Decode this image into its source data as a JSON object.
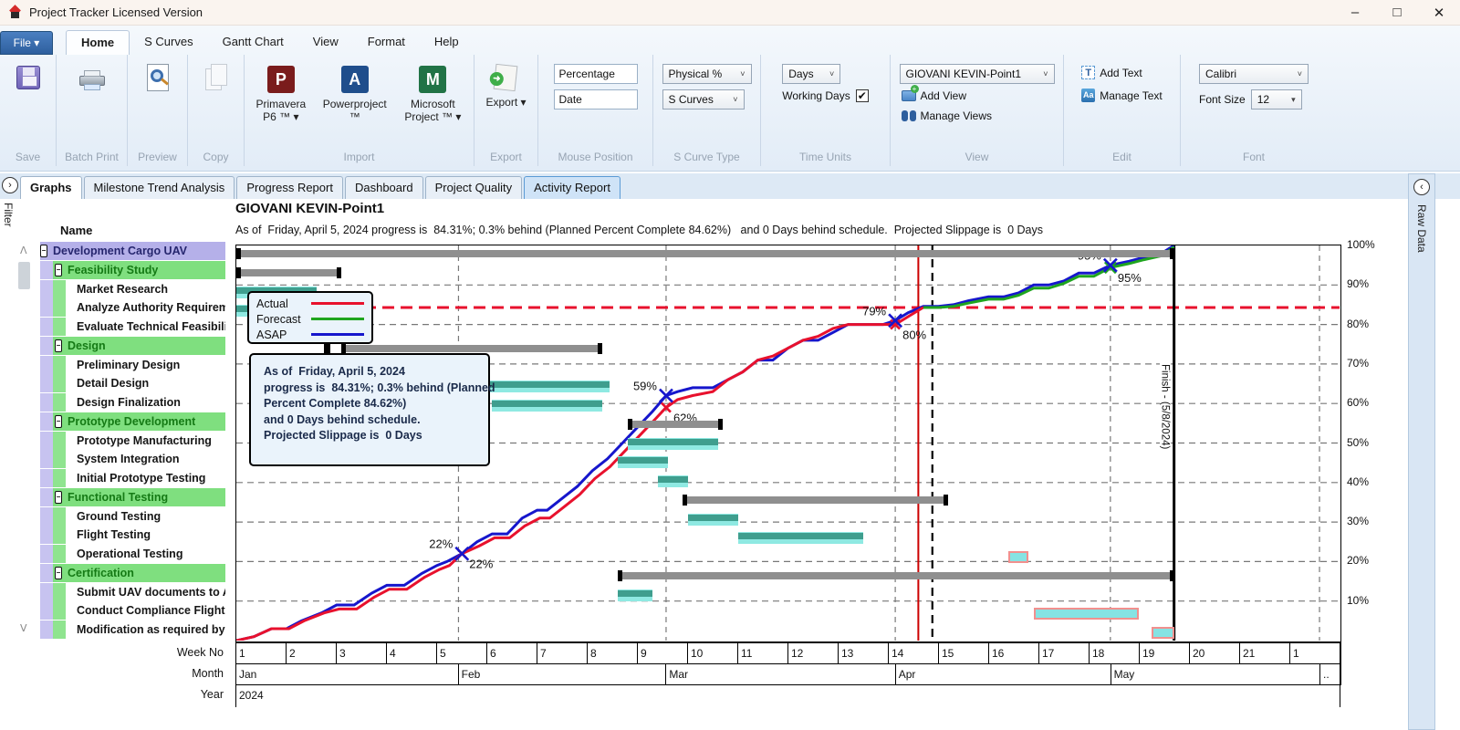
{
  "window": {
    "title": "Project Tracker Licensed Version",
    "controls": {
      "minimize": "–",
      "maximize": "□",
      "close": "✕"
    }
  },
  "menu": {
    "file_label": "File ▾",
    "tabs": [
      {
        "label": "Home",
        "state": "active"
      },
      {
        "label": "S Curves",
        "state": "normal"
      },
      {
        "label": "Gantt Chart",
        "state": "normal"
      },
      {
        "label": "View",
        "state": "normal"
      },
      {
        "label": "Format",
        "state": "normal"
      },
      {
        "label": "Help",
        "state": "normal"
      }
    ]
  },
  "ribbon": {
    "save": {
      "button": "Save",
      "group_label": "Save"
    },
    "batch_print": {
      "button": "Batch Print",
      "group_label": "Batch Print"
    },
    "preview": {
      "button": "Preview",
      "group_label": "Preview"
    },
    "copy": {
      "button": "Copy",
      "group_label": "Copy"
    },
    "import": {
      "primavera": "Primavera P6 ™ ▾",
      "powerproject": "Powerproject ™",
      "msproject": "Microsoft Project ™ ▾",
      "group_label": "Import"
    },
    "export": {
      "button": "Export ▾",
      "group_label": "Export"
    },
    "mouse_position": {
      "field1": "Percentage",
      "field2": "Date",
      "group_label": "Mouse Position"
    },
    "s_curve_type": {
      "dropdown1": "Physical %",
      "dropdown2": "S Curves",
      "group_label": "S Curve Type"
    },
    "time_units": {
      "dropdown": "Days",
      "checkbox_label": "Working Days",
      "checkbox_checked": "✔",
      "group_label": "Time Units"
    },
    "view": {
      "dropdown": "GIOVANI KEVIN-Point1",
      "add_view": "Add View",
      "manage_views": "Manage Views",
      "group_label": "View"
    },
    "edit": {
      "add_text": "Add Text",
      "manage_text": "Manage Text",
      "group_label": "Edit"
    },
    "font": {
      "family": "Calibri",
      "size_label": "Font Size",
      "size_value": "12",
      "group_label": "Font"
    }
  },
  "content_tabs": [
    {
      "label": "Graphs",
      "state": "active"
    },
    {
      "label": "Milestone Trend Analysis",
      "state": "normal"
    },
    {
      "label": "Progress Report",
      "state": "normal"
    },
    {
      "label": "Dashboard",
      "state": "normal"
    },
    {
      "label": "Project Quality",
      "state": "normal"
    },
    {
      "label": "Activity Report",
      "state": "highlight"
    }
  ],
  "left_rail": {
    "filter_label": "Filter",
    "expander": "›"
  },
  "right_rail": {
    "raw_data_label": "Raw Data",
    "collapser": "‹"
  },
  "tree": {
    "header": "Name",
    "items": [
      {
        "label": "Development Cargo UAV",
        "kind": "root"
      },
      {
        "label": "Feasibility Study",
        "kind": "summary"
      },
      {
        "label": "Market Research",
        "kind": "leaf"
      },
      {
        "label": "Analyze Authority Requireme...",
        "kind": "leaf"
      },
      {
        "label": "Evaluate Technical Feasibility",
        "kind": "leaf"
      },
      {
        "label": "Design",
        "kind": "summary"
      },
      {
        "label": "Preliminary Design",
        "kind": "leaf"
      },
      {
        "label": "Detail Design",
        "kind": "leaf"
      },
      {
        "label": "Design Finalization",
        "kind": "leaf"
      },
      {
        "label": "Prototype Development",
        "kind": "summary"
      },
      {
        "label": "Prototype Manufacturing",
        "kind": "leaf"
      },
      {
        "label": "System Integration",
        "kind": "leaf"
      },
      {
        "label": "Initial Prototype Testing",
        "kind": "leaf"
      },
      {
        "label": "Functional Testing",
        "kind": "summary"
      },
      {
        "label": "Ground Testing",
        "kind": "leaf"
      },
      {
        "label": "Flight Testing",
        "kind": "leaf"
      },
      {
        "label": "Operational Testing",
        "kind": "leaf"
      },
      {
        "label": "Certification",
        "kind": "summary"
      },
      {
        "label": "Submit UAV documents to Aut...",
        "kind": "leaf"
      },
      {
        "label": "Conduct Compliance Flight Test",
        "kind": "leaf"
      },
      {
        "label": "Modification as required by a...",
        "kind": "leaf"
      }
    ],
    "toggle_glyph": "−",
    "scroll_up": "ᐱ",
    "scroll_down": "ᐯ"
  },
  "chart": {
    "title": "GIOVANI KEVIN-Point1",
    "subtitle": "As of  Friday, April 5, 2024 progress is  84.31%; 0.3% behind (Planned Percent Complete 84.62%)   and 0 Days behind schedule.  Projected Slippage is  0 Days",
    "annotation_lines": [
      "As of  Friday, April 5, 2024",
      "progress is  84.31%; 0.3% behind (Planned",
      "Percent Complete 84.62%)",
      "and 0 Days behind schedule.",
      "Projected Slippage is  0 Days"
    ],
    "finish_line_label": "Finish - (5/8/2024)",
    "axis_row_labels": {
      "week": "Week No",
      "month": "Month",
      "year": "Year"
    }
  },
  "chart_data": {
    "type": "line",
    "title": "GIOVANI KEVIN-Point1",
    "x_unit": "weeks",
    "x_range": [
      0,
      22
    ],
    "y_axis_labels": [
      "100%",
      "90%",
      "80%",
      "70%",
      "60%",
      "50%",
      "40%",
      "30%",
      "20%",
      "10%"
    ],
    "ylim": [
      0,
      100
    ],
    "grid": "dashed",
    "legend_position": "top-left",
    "legend": [
      {
        "name": "Actual",
        "color": "#e8112d"
      },
      {
        "name": "Forecast",
        "color": "#1fa51f"
      },
      {
        "name": "ASAP",
        "color": "#1616cc"
      }
    ],
    "week_labels": [
      "1",
      "2",
      "3",
      "4",
      "5",
      "6",
      "7",
      "8",
      "9",
      "10",
      "11",
      "12",
      "13",
      "14",
      "15",
      "16",
      "17",
      "18",
      "19",
      "20",
      "21",
      "1"
    ],
    "months": [
      {
        "label": "Jan",
        "start": 0,
        "end": 4.43
      },
      {
        "label": "Feb",
        "start": 4.43,
        "end": 8.57
      },
      {
        "label": "Mar",
        "start": 8.57,
        "end": 13.14
      },
      {
        "label": "Apr",
        "start": 13.14,
        "end": 17.43
      },
      {
        "label": "May",
        "start": 17.43,
        "end": 21.6
      },
      {
        "label": "..",
        "start": 21.6,
        "end": 22
      }
    ],
    "year": "2024",
    "month_gridlines": [
      4.43,
      8.57,
      13.14,
      17.43,
      21.6
    ],
    "status_line": {
      "week": 13.6,
      "color": "#cc0000",
      "style": "solid"
    },
    "status_line_dashed": {
      "week": 13.88,
      "color": "#000000",
      "style": "dashed"
    },
    "finish_line": {
      "week": 18.7,
      "color": "#000000",
      "label": "Finish - (5/8/2024)"
    },
    "progress_reference_line": {
      "percent": 84.31,
      "color": "#e8112d",
      "style": "dashed"
    },
    "series": [
      {
        "name": "ASAP",
        "color": "#1616cc",
        "points": [
          [
            0,
            0
          ],
          [
            0.35,
            1
          ],
          [
            0.7,
            3
          ],
          [
            1.0,
            3
          ],
          [
            1.3,
            5
          ],
          [
            1.7,
            7
          ],
          [
            2.0,
            9
          ],
          [
            2.35,
            9
          ],
          [
            2.7,
            12
          ],
          [
            3.0,
            14
          ],
          [
            3.35,
            14
          ],
          [
            3.7,
            17
          ],
          [
            4.0,
            19
          ],
          [
            4.2,
            20
          ],
          [
            4.5,
            22
          ],
          [
            4.8,
            25
          ],
          [
            5.1,
            27
          ],
          [
            5.4,
            27
          ],
          [
            5.7,
            31
          ],
          [
            6.0,
            33
          ],
          [
            6.2,
            33
          ],
          [
            6.5,
            36
          ],
          [
            6.8,
            39
          ],
          [
            7.1,
            43
          ],
          [
            7.4,
            46
          ],
          [
            7.7,
            50
          ],
          [
            8.0,
            54
          ],
          [
            8.3,
            58
          ],
          [
            8.57,
            62
          ],
          [
            8.8,
            63
          ],
          [
            9.1,
            64
          ],
          [
            9.5,
            64
          ],
          [
            9.8,
            66
          ],
          [
            10.1,
            68
          ],
          [
            10.4,
            71
          ],
          [
            10.7,
            71
          ],
          [
            11.0,
            74
          ],
          [
            11.3,
            76
          ],
          [
            11.6,
            76
          ],
          [
            11.9,
            78
          ],
          [
            12.2,
            80
          ],
          [
            12.9,
            80
          ],
          [
            13.14,
            81
          ],
          [
            13.4,
            83
          ],
          [
            13.7,
            84.6
          ],
          [
            14.0,
            84.6
          ],
          [
            14.3,
            85
          ],
          [
            14.6,
            86
          ],
          [
            15.0,
            87
          ],
          [
            15.3,
            87
          ],
          [
            15.6,
            88
          ],
          [
            15.9,
            90
          ],
          [
            16.2,
            90
          ],
          [
            16.5,
            91
          ],
          [
            16.8,
            93
          ],
          [
            17.1,
            93
          ],
          [
            17.43,
            95
          ],
          [
            17.8,
            96
          ],
          [
            18.1,
            97
          ],
          [
            18.45,
            98
          ],
          [
            18.7,
            100
          ]
        ]
      },
      {
        "name": "Actual",
        "color": "#e8112d",
        "points": [
          [
            0,
            0
          ],
          [
            0.35,
            1
          ],
          [
            0.7,
            3
          ],
          [
            1.05,
            3
          ],
          [
            1.35,
            5
          ],
          [
            1.75,
            7
          ],
          [
            2.05,
            8
          ],
          [
            2.4,
            8
          ],
          [
            2.75,
            11
          ],
          [
            3.05,
            13
          ],
          [
            3.4,
            13
          ],
          [
            3.75,
            16
          ],
          [
            4.05,
            18
          ],
          [
            4.25,
            19
          ],
          [
            4.5,
            22
          ],
          [
            4.85,
            24
          ],
          [
            5.15,
            26
          ],
          [
            5.45,
            26
          ],
          [
            5.75,
            29
          ],
          [
            6.05,
            31
          ],
          [
            6.25,
            31
          ],
          [
            6.55,
            34
          ],
          [
            6.85,
            37
          ],
          [
            7.15,
            41
          ],
          [
            7.45,
            44
          ],
          [
            7.75,
            48
          ],
          [
            8.05,
            52
          ],
          [
            8.35,
            56
          ],
          [
            8.57,
            59
          ],
          [
            8.8,
            61
          ],
          [
            9.1,
            62
          ],
          [
            9.5,
            63
          ],
          [
            9.8,
            66
          ],
          [
            10.1,
            68
          ],
          [
            10.4,
            71
          ],
          [
            10.7,
            72
          ],
          [
            11.0,
            74
          ],
          [
            11.3,
            76
          ],
          [
            11.6,
            77
          ],
          [
            11.9,
            79
          ],
          [
            12.2,
            80
          ],
          [
            12.9,
            80
          ],
          [
            13.14,
            80
          ],
          [
            13.4,
            82
          ],
          [
            13.7,
            84.31
          ]
        ]
      },
      {
        "name": "Forecast",
        "color": "#1fa51f",
        "points": [
          [
            13.7,
            84.3
          ],
          [
            14.0,
            84.3
          ],
          [
            14.3,
            84.6
          ],
          [
            14.6,
            85.4
          ],
          [
            15.0,
            86.4
          ],
          [
            15.3,
            86.4
          ],
          [
            15.6,
            87.4
          ],
          [
            15.9,
            89.2
          ],
          [
            16.2,
            89.2
          ],
          [
            16.5,
            90.4
          ],
          [
            16.8,
            92.2
          ],
          [
            17.1,
            92.2
          ],
          [
            17.43,
            94.4
          ],
          [
            17.8,
            95.4
          ],
          [
            18.1,
            96.4
          ],
          [
            18.45,
            97.4
          ],
          [
            18.7,
            99.6
          ]
        ]
      }
    ],
    "markers": [
      {
        "week": 4.5,
        "blue": 22,
        "red": 22,
        "label_hi": "22%",
        "label_lo": "22%"
      },
      {
        "week": 8.57,
        "blue": 62,
        "red": 59,
        "label_hi": "59%",
        "label_lo": "62%"
      },
      {
        "week": 13.14,
        "blue": 81,
        "red": 80,
        "label_hi": "79%",
        "label_lo": "80%"
      },
      {
        "week": 17.43,
        "blue": 95,
        "green": 94.4,
        "label_hi": "95%",
        "label_lo": "95%"
      }
    ],
    "gantt_bars": [
      {
        "task": "Development Cargo UAV",
        "row": 0,
        "start": 0,
        "end": 18.7,
        "type": "summary"
      },
      {
        "task": "Feasibility Study",
        "row": 1,
        "start": 0,
        "end": 2.1,
        "type": "summary"
      },
      {
        "task": "Market Research",
        "row": 2,
        "start": 0,
        "end": 1.6,
        "type": "task"
      },
      {
        "task": "Analyze Authority Requirements",
        "row": 3,
        "start": 0,
        "end": 2.1,
        "type": "task"
      },
      {
        "task": "Evaluate Technical Feasibility",
        "row": 4,
        "start": 0.9,
        "end": 2.1,
        "type": "task"
      },
      {
        "task": "Design",
        "row": 5,
        "start": 2.1,
        "end": 7.3,
        "type": "summary"
      },
      {
        "task": "Preliminary Design",
        "row": 6,
        "start": 2.2,
        "end": 5.0,
        "type": "task"
      },
      {
        "task": "Detail Design",
        "row": 7,
        "start": 3.0,
        "end": 7.45,
        "type": "task"
      },
      {
        "task": "Design Finalization",
        "row": 8,
        "start": 5.1,
        "end": 7.3,
        "type": "task"
      },
      {
        "task": "Prototype Development",
        "row": 9,
        "start": 7.8,
        "end": 9.7,
        "type": "summary"
      },
      {
        "task": "Prototype Manufacturing",
        "row": 10,
        "start": 7.8,
        "end": 9.6,
        "type": "task"
      },
      {
        "task": "System Integration",
        "row": 11,
        "start": 7.6,
        "end": 8.6,
        "type": "task"
      },
      {
        "task": "Initial Prototype Testing",
        "row": 12,
        "start": 8.4,
        "end": 9.0,
        "type": "task"
      },
      {
        "task": "Functional Testing",
        "row": 13,
        "start": 8.9,
        "end": 14.2,
        "type": "summary"
      },
      {
        "task": "Ground Testing",
        "row": 14,
        "start": 9.0,
        "end": 10.0,
        "type": "task"
      },
      {
        "task": "Flight Testing",
        "row": 15,
        "start": 10.0,
        "end": 12.5,
        "type": "task"
      },
      {
        "task": "Operational Testing",
        "row": 16,
        "start": 15.4,
        "end": 15.8,
        "type": "critical"
      },
      {
        "task": "Certification",
        "row": 17,
        "start": 7.6,
        "end": 18.7,
        "type": "summary"
      },
      {
        "task": "Submit UAV documents to Authority",
        "row": 18,
        "start": 7.6,
        "end": 8.3,
        "type": "task"
      },
      {
        "task": "Conduct Compliance Flight Test",
        "row": 19,
        "start": 15.9,
        "end": 18.0,
        "type": "critical"
      },
      {
        "task": "Modification as required",
        "row": 20,
        "start": 18.25,
        "end": 18.7,
        "type": "critical"
      }
    ]
  }
}
